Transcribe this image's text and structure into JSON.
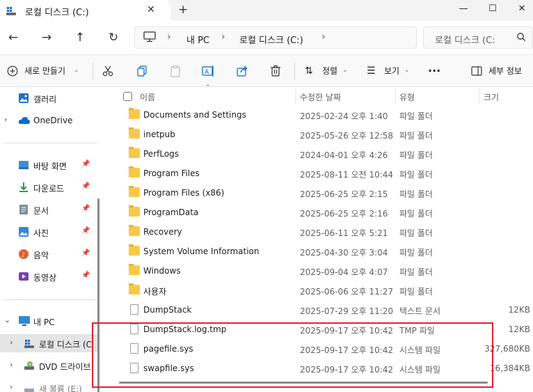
{
  "window": {
    "tab_title": "로컬 디스크 (C:)",
    "tab_close": "✕",
    "new_tab": "+",
    "minimize": "—",
    "maximize": "☐",
    "close": "✕"
  },
  "address": {
    "back": "←",
    "forward": "→",
    "up": "↑",
    "refresh": "↻",
    "crumbs": [
      "내 PC",
      "로컬 디스크 (C:)"
    ],
    "search_placeholder": "로컬 디스크 (C:"
  },
  "toolbar": {
    "new_label": "새로 만들기",
    "sort_label": "정렬",
    "view_label": "보기",
    "more": "···",
    "details_label": "세부 정보"
  },
  "sidebar": {
    "items": [
      {
        "label": "갤러리",
        "icon": "gallery-icon"
      },
      {
        "label": "OneDrive",
        "icon": "onedrive-icon"
      },
      {
        "label": "바탕 화면",
        "icon": "desktop-icon"
      },
      {
        "label": "다운로드",
        "icon": "download-icon"
      },
      {
        "label": "문서",
        "icon": "document-icon"
      },
      {
        "label": "사진",
        "icon": "pictures-icon"
      },
      {
        "label": "음악",
        "icon": "music-icon"
      },
      {
        "label": "동영상",
        "icon": "video-icon"
      },
      {
        "label": "내 PC",
        "icon": "pc-icon"
      },
      {
        "label": "로컬 디스크 (C",
        "icon": "drive-icon"
      },
      {
        "label": "DVD 드라이브",
        "icon": "dvd-icon"
      },
      {
        "label": "새 볼륨 (E:)",
        "icon": "volume-icon"
      }
    ]
  },
  "columns": {
    "name": "이름",
    "date": "수정한 날짜",
    "type": "유형",
    "size": "크기"
  },
  "files": [
    {
      "name": "Documents and Settings",
      "date": "2025-02-24 오후 1:40",
      "type": "파일 폴더",
      "size": "",
      "kind": "folder"
    },
    {
      "name": "inetpub",
      "date": "2025-05-26 오후 12:58",
      "type": "파일 폴더",
      "size": "",
      "kind": "folder"
    },
    {
      "name": "PerfLogs",
      "date": "2024-04-01 오후 4:26",
      "type": "파일 폴더",
      "size": "",
      "kind": "folder"
    },
    {
      "name": "Program Files",
      "date": "2025-08-11 오전 10:44",
      "type": "파일 폴더",
      "size": "",
      "kind": "folder"
    },
    {
      "name": "Program Files (x86)",
      "date": "2025-06-25 오후 2:15",
      "type": "파일 폴더",
      "size": "",
      "kind": "folder"
    },
    {
      "name": "ProgramData",
      "date": "2025-06-25 오후 2:16",
      "type": "파일 폴더",
      "size": "",
      "kind": "folder"
    },
    {
      "name": "Recovery",
      "date": "2025-06-11 오후 5:21",
      "type": "파일 폴더",
      "size": "",
      "kind": "folder"
    },
    {
      "name": "System Volume Information",
      "date": "2025-04-30 오후 3:04",
      "type": "파일 폴더",
      "size": "",
      "kind": "folder"
    },
    {
      "name": "Windows",
      "date": "2025-09-04 오후 4:07",
      "type": "파일 폴더",
      "size": "",
      "kind": "folder"
    },
    {
      "name": "사용자",
      "date": "2025-06-06 오후 11:27",
      "type": "파일 폴더",
      "size": "",
      "kind": "folder"
    },
    {
      "name": "DumpStack",
      "date": "2025-07-29 오후 11:20",
      "type": "텍스트 문서",
      "size": "12KB",
      "kind": "file"
    },
    {
      "name": "DumpStack.log.tmp",
      "date": "2025-09-17 오후 10:42",
      "type": "TMP 파일",
      "size": "12KB",
      "kind": "file"
    },
    {
      "name": "pagefile.sys",
      "date": "2025-09-17 오후 10:42",
      "type": "시스템 파일",
      "size": "327,680KB",
      "kind": "file"
    },
    {
      "name": "swapfile.sys",
      "date": "2025-09-17 오후 10:42",
      "type": "시스템 파일",
      "size": "16,384KB",
      "kind": "file"
    }
  ],
  "colors": {
    "highlight": "#e5202e",
    "folder": "#f7c948",
    "accent": "#0067c0"
  }
}
